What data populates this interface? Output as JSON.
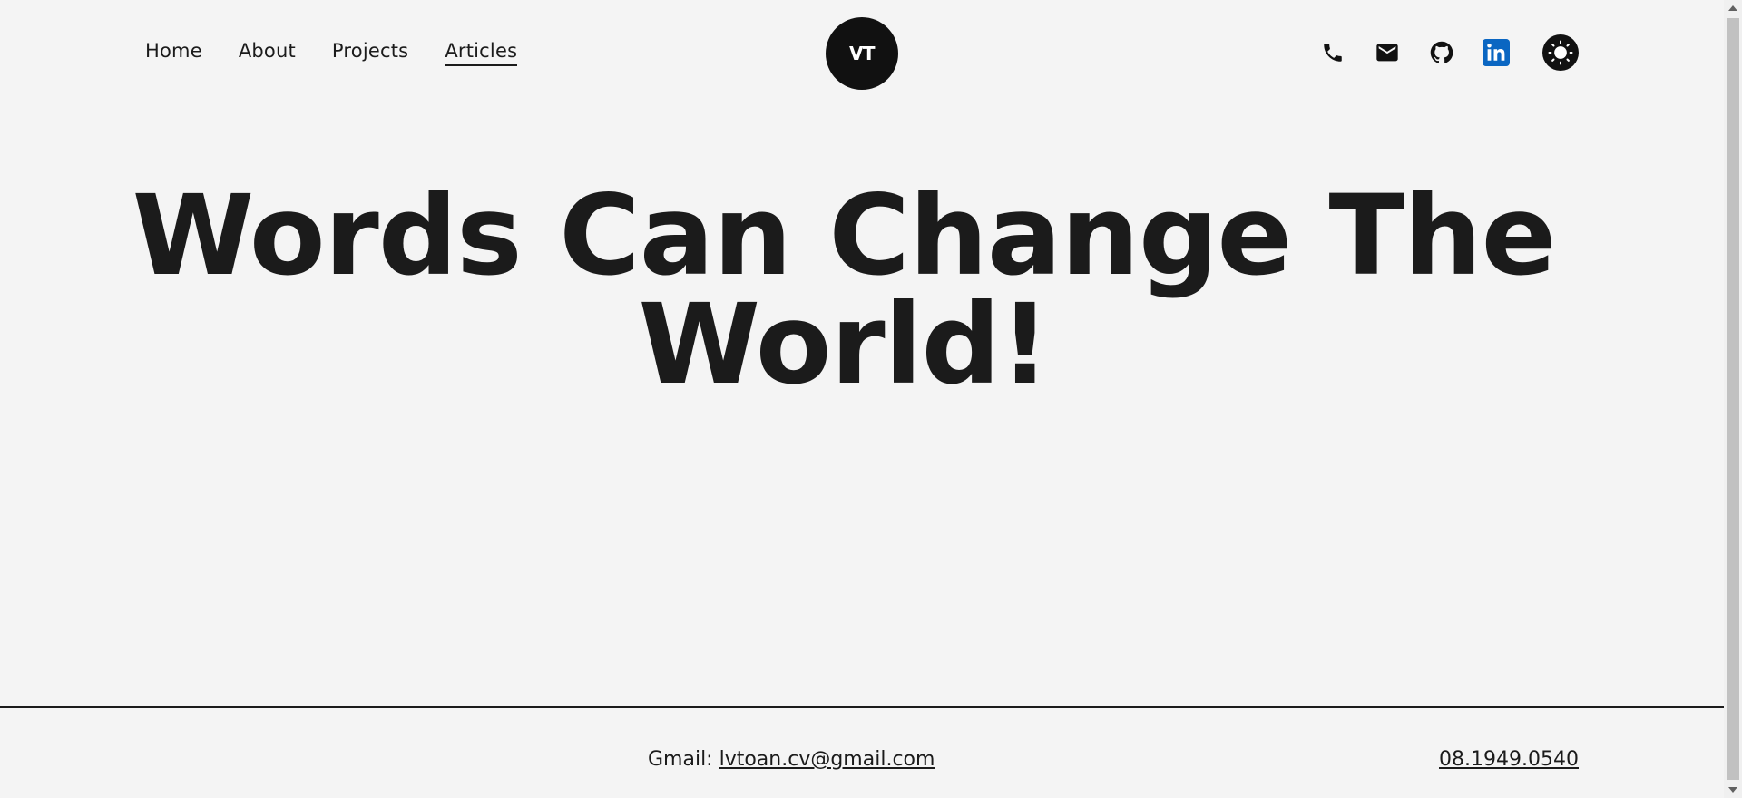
{
  "nav": {
    "items": [
      {
        "label": "Home",
        "active": false
      },
      {
        "label": "About",
        "active": false
      },
      {
        "label": "Projects",
        "active": false
      },
      {
        "label": "Articles",
        "active": true
      }
    ]
  },
  "logo": {
    "text": "VT"
  },
  "socials": {
    "icons": [
      "phone-icon",
      "mail-icon",
      "github-icon",
      "linkedin-icon",
      "theme-toggle-icon"
    ],
    "linkedin_color": "#0a66c2"
  },
  "hero": {
    "line1": "Words Can Change The",
    "line2": "World!"
  },
  "footer": {
    "gmail_label": "Gmail: ",
    "gmail_value": "lvtoan.cv@gmail.com",
    "phone": "08.1949.0540"
  },
  "colors": {
    "background": "#f4f4f4",
    "text": "#1b1b1b",
    "logo_bg": "#111111"
  }
}
